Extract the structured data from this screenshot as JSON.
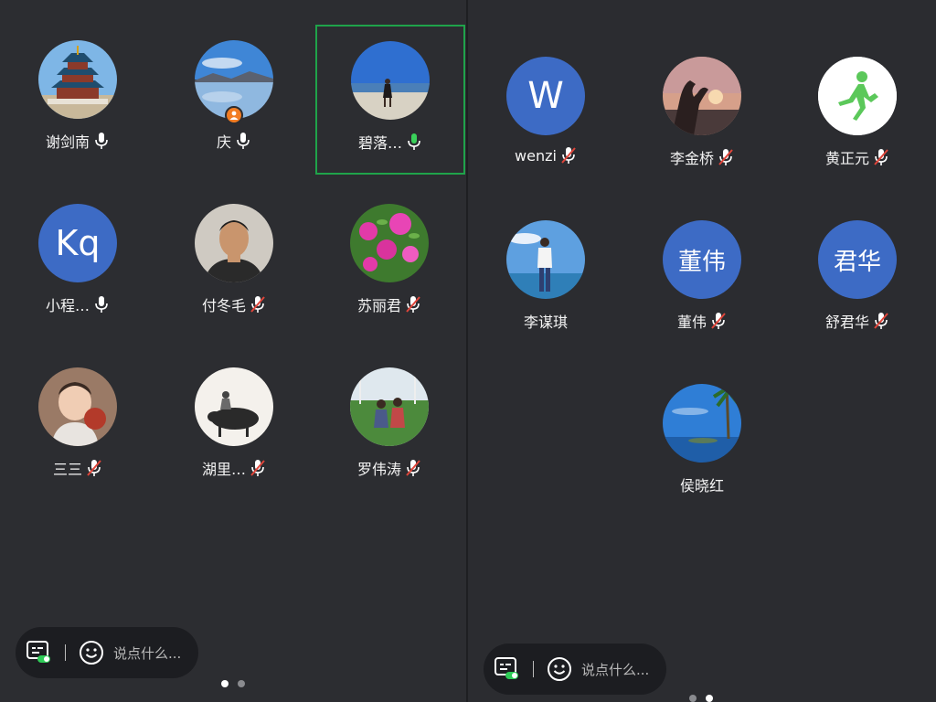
{
  "left_panel": {
    "participants": [
      {
        "name": "谢剑南",
        "mic": "on"
      },
      {
        "name": "庆",
        "mic": "on",
        "host": true
      },
      {
        "name": "碧落…",
        "mic": "active",
        "highlighted": true
      },
      {
        "name": "小程…",
        "mic": "on",
        "initials": "Kq"
      },
      {
        "name": "付冬毛",
        "mic": "muted"
      },
      {
        "name": "苏丽君",
        "mic": "muted"
      },
      {
        "name": "三三",
        "mic": "muted"
      },
      {
        "name": "湖里…",
        "mic": "muted"
      },
      {
        "name": "罗伟涛",
        "mic": "muted"
      }
    ],
    "chat_placeholder": "说点什么...",
    "page_dots": {
      "total": 2,
      "active": 1
    }
  },
  "right_panel": {
    "participants": [
      {
        "name": "wenzi",
        "mic": "muted",
        "initials": "W"
      },
      {
        "name": "李金桥",
        "mic": "muted"
      },
      {
        "name": "黄正元",
        "mic": "muted"
      },
      {
        "name": "李谋琪",
        "mic": "none"
      },
      {
        "name": "董伟",
        "mic": "muted",
        "initials": "董伟"
      },
      {
        "name": "舒君华",
        "mic": "muted",
        "initials": "君华"
      },
      {
        "name": "侯晓红",
        "mic": "none"
      }
    ],
    "chat_placeholder": "说点什么...",
    "page_dots": {
      "total": 2,
      "active": 2
    }
  },
  "colors": {
    "background": "#2c2d31",
    "accent_green": "#1fa34a",
    "initial_avatar": "#3d6bc5",
    "host_badge": "#f27c22",
    "mute_slash": "#e0453a"
  }
}
